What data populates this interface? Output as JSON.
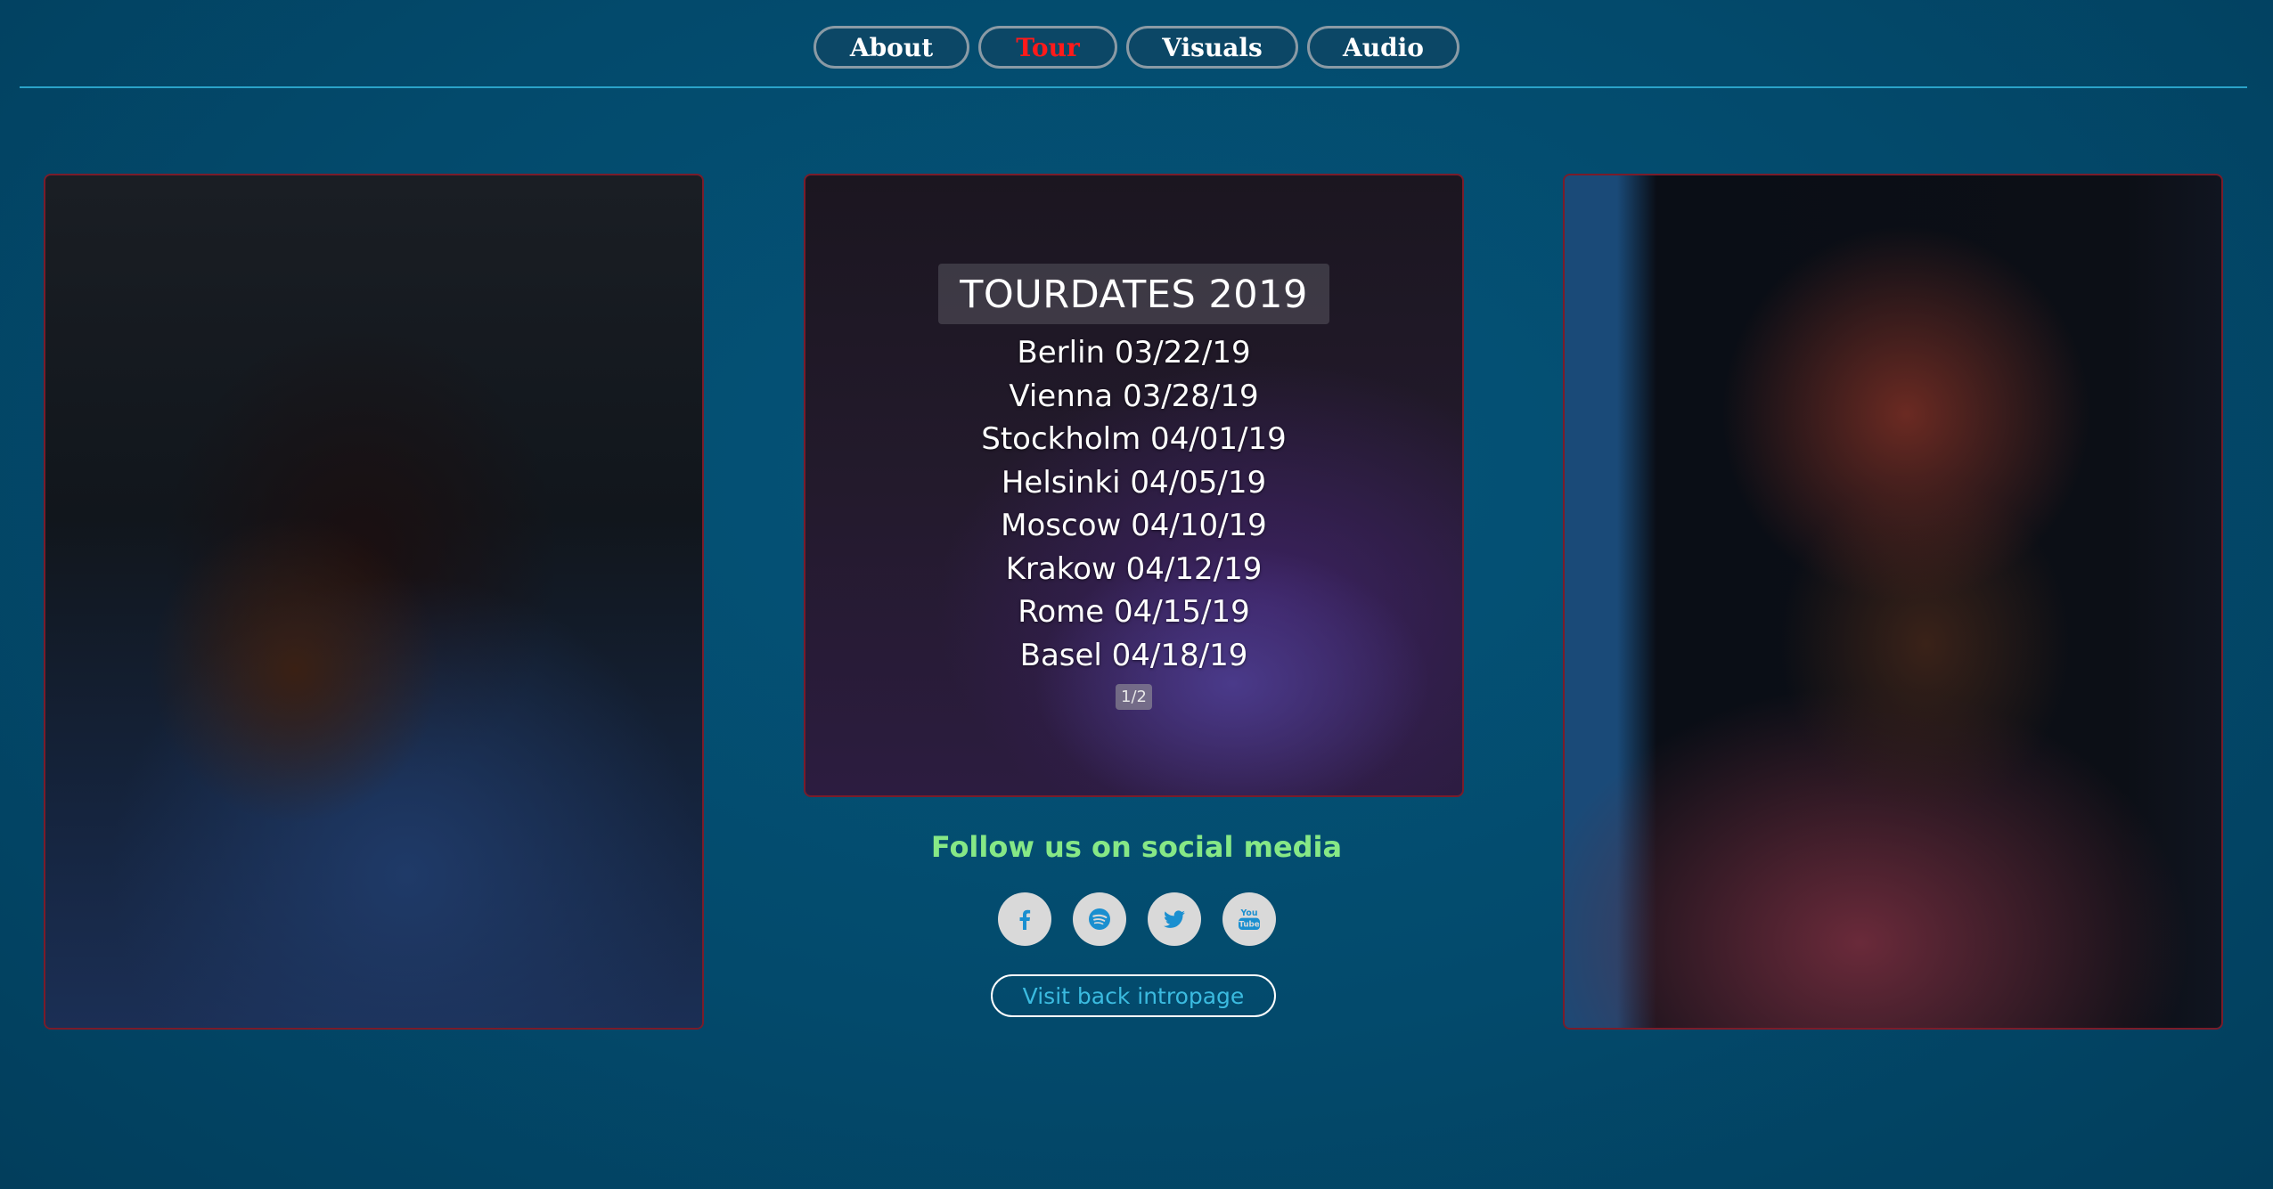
{
  "nav": {
    "items": [
      {
        "label": "About"
      },
      {
        "label": "Tour"
      },
      {
        "label": "Visuals"
      },
      {
        "label": "Audio"
      }
    ],
    "active": "Tour"
  },
  "tour": {
    "title": "TOURDATES 2019",
    "dates": [
      "Berlin 03/22/19",
      "Vienna 03/28/19",
      "Stockholm 04/01/19",
      "Helsinki 04/05/19",
      "Moscow 04/10/19",
      "Krakow 04/12/19",
      "Rome 04/15/19",
      "Basel 04/18/19"
    ],
    "pager": "1/2"
  },
  "social": {
    "heading": "Follow us on social media",
    "icons": [
      "facebook-icon",
      "spotify-icon",
      "twitter-icon",
      "youtube-icon"
    ]
  },
  "visit_button": "Visit back intropage",
  "colors": {
    "background": "#034b6d",
    "active_nav": "#ff1a1a",
    "follow_heading": "#86e886",
    "visit_text": "#3bbbe0",
    "panel_border": "#7a1c2a"
  }
}
